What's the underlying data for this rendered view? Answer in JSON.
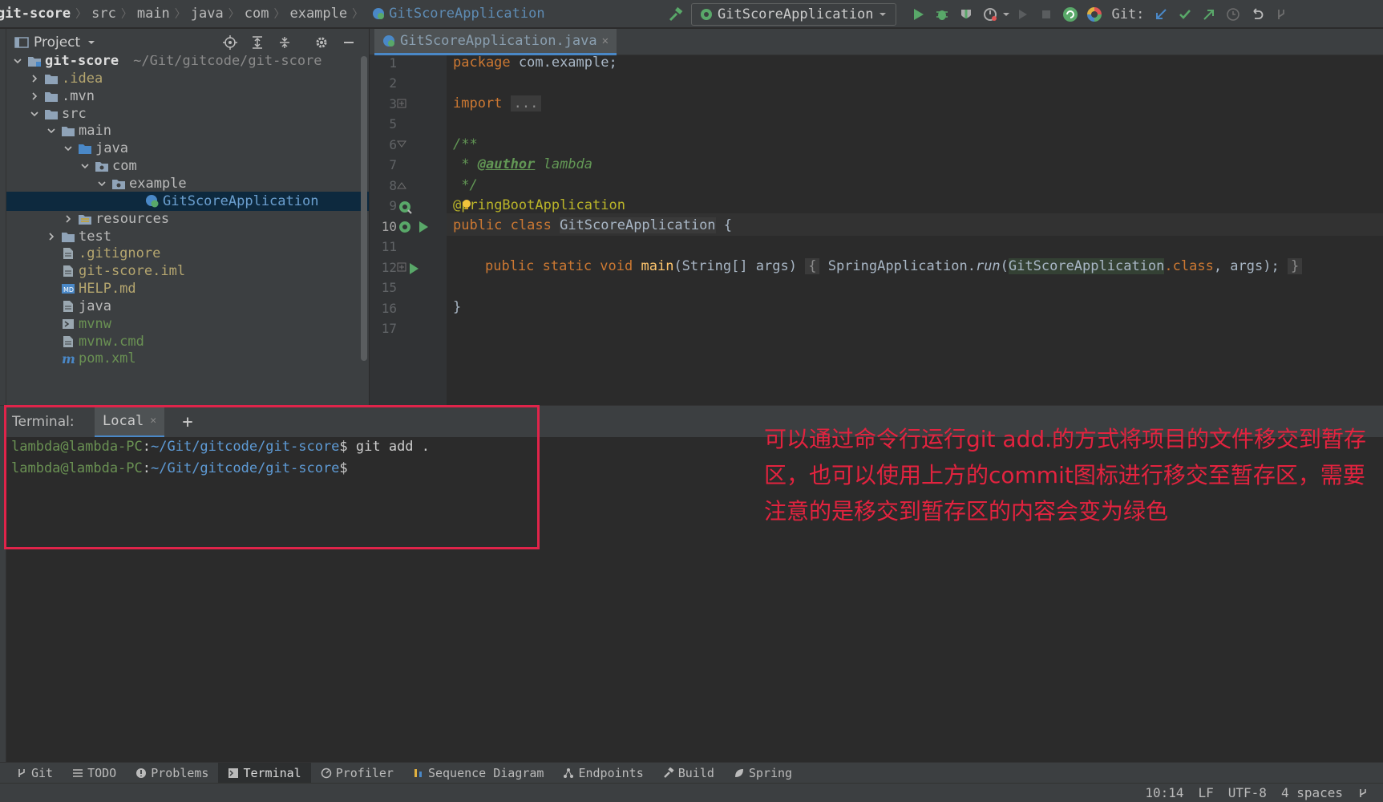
{
  "breadcrumb": [
    "git-score",
    "src",
    "main",
    "java",
    "com",
    "example",
    "GitScoreApplication"
  ],
  "toolbar": {
    "run_config": "GitScoreApplication",
    "git_label": "Git:"
  },
  "project": {
    "title": "Project",
    "tree": [
      {
        "label": "git-score",
        "hint": "~/Git/gitcode/git-score",
        "depth": 0,
        "arrow": "down",
        "icon": "module-folder-icon",
        "color": "white"
      },
      {
        "label": ".idea",
        "depth": 1,
        "arrow": "right",
        "icon": "folder-icon",
        "color": "olive"
      },
      {
        "label": ".mvn",
        "depth": 1,
        "arrow": "right",
        "icon": "folder-icon",
        "color": "default"
      },
      {
        "label": "src",
        "depth": 1,
        "arrow": "down",
        "icon": "folder-icon",
        "color": "default"
      },
      {
        "label": "main",
        "depth": 2,
        "arrow": "down",
        "icon": "folder-icon",
        "color": "default"
      },
      {
        "label": "java",
        "depth": 3,
        "arrow": "down",
        "icon": "source-folder-icon",
        "color": "default"
      },
      {
        "label": "com",
        "depth": 4,
        "arrow": "down",
        "icon": "package-icon",
        "color": "default"
      },
      {
        "label": "example",
        "depth": 5,
        "arrow": "down",
        "icon": "package-icon",
        "color": "default"
      },
      {
        "label": "GitScoreApplication",
        "depth": 7,
        "arrow": "",
        "icon": "spring-class-icon",
        "color": "blue",
        "selected": true
      },
      {
        "label": "resources",
        "depth": 3,
        "arrow": "right",
        "icon": "resources-folder-icon",
        "color": "default"
      },
      {
        "label": "test",
        "depth": 2,
        "arrow": "right",
        "icon": "folder-icon",
        "color": "default"
      },
      {
        "label": ".gitignore",
        "depth": 2,
        "arrow": "",
        "icon": "file-icon",
        "color": "olive"
      },
      {
        "label": "git-score.iml",
        "depth": 2,
        "arrow": "",
        "icon": "file-icon",
        "color": "olive"
      },
      {
        "label": "HELP.md",
        "depth": 2,
        "arrow": "",
        "icon": "markdown-icon",
        "color": "olive"
      },
      {
        "label": "java",
        "depth": 2,
        "arrow": "",
        "icon": "file-icon",
        "color": "default"
      },
      {
        "label": "mvnw",
        "depth": 2,
        "arrow": "",
        "icon": "script-icon",
        "color": "green"
      },
      {
        "label": "mvnw.cmd",
        "depth": 2,
        "arrow": "",
        "icon": "file-icon",
        "color": "green"
      },
      {
        "label": "pom.xml",
        "depth": 2,
        "arrow": "",
        "icon": "maven-icon",
        "color": "green"
      }
    ]
  },
  "editor": {
    "tab": "GitScoreApplication.java",
    "line_numbers": [
      "1",
      "2",
      "3",
      "5",
      "6",
      "7",
      "8",
      "9",
      "10",
      "11",
      "12",
      "15",
      "16",
      "17"
    ],
    "code": {
      "l1_kw": "package",
      "l1_rest": " com.example;",
      "l3_kw": "import",
      "l3_fold": "...",
      "l6": "/**",
      "l7_star": " * ",
      "l7_tag": "@author",
      "l7_name": " lambda",
      "l8": " */",
      "l9_at": "@",
      "l9_ann": "pringBootApplication",
      "l10_kw": "public class",
      "l10_cls": "GitScoreApplication",
      "l10_brace": " {",
      "l12_kw": "public static void",
      "l12_fn": "main",
      "l12_args": "(String[] args)",
      "l12_open": "{",
      "l12_call": "SpringApplication.",
      "l12_run": "run",
      "l12_paren": "(",
      "l12_cls": "GitScoreApplication",
      "l12_dotclass": ".class",
      "l12_tail": ", args);",
      "l12_close": "}",
      "l16": "}"
    }
  },
  "terminal": {
    "title": "Terminal:",
    "tab": "Local",
    "lines": [
      {
        "user": "lambda@lambda-PC",
        "sep": ":",
        "path": "~/Git/gitcode/git-score",
        "cmd": "$ git add ."
      },
      {
        "user": "lambda@lambda-PC",
        "sep": ":",
        "path": "~/Git/gitcode/git-score",
        "cmd": "$"
      }
    ]
  },
  "annotation": "可以通过命令行运行git add.的方式将项目的文件移交到暂存区，也可以使用上方的commit图标进行移交至暂存区，需要注意的是移交到暂存区的内容会变为绿色",
  "toolwindows": [
    "Git",
    "TODO",
    "Problems",
    "Terminal",
    "Profiler",
    "Sequence Diagram",
    "Endpoints",
    "Build",
    "Spring"
  ],
  "status": {
    "position": "10:14",
    "line_sep": "LF",
    "encoding": "UTF-8",
    "indent": "4 spaces"
  },
  "colors": {
    "accent": "#4a88c7",
    "annotation_red": "#e3233f",
    "run_green": "#59a869"
  }
}
